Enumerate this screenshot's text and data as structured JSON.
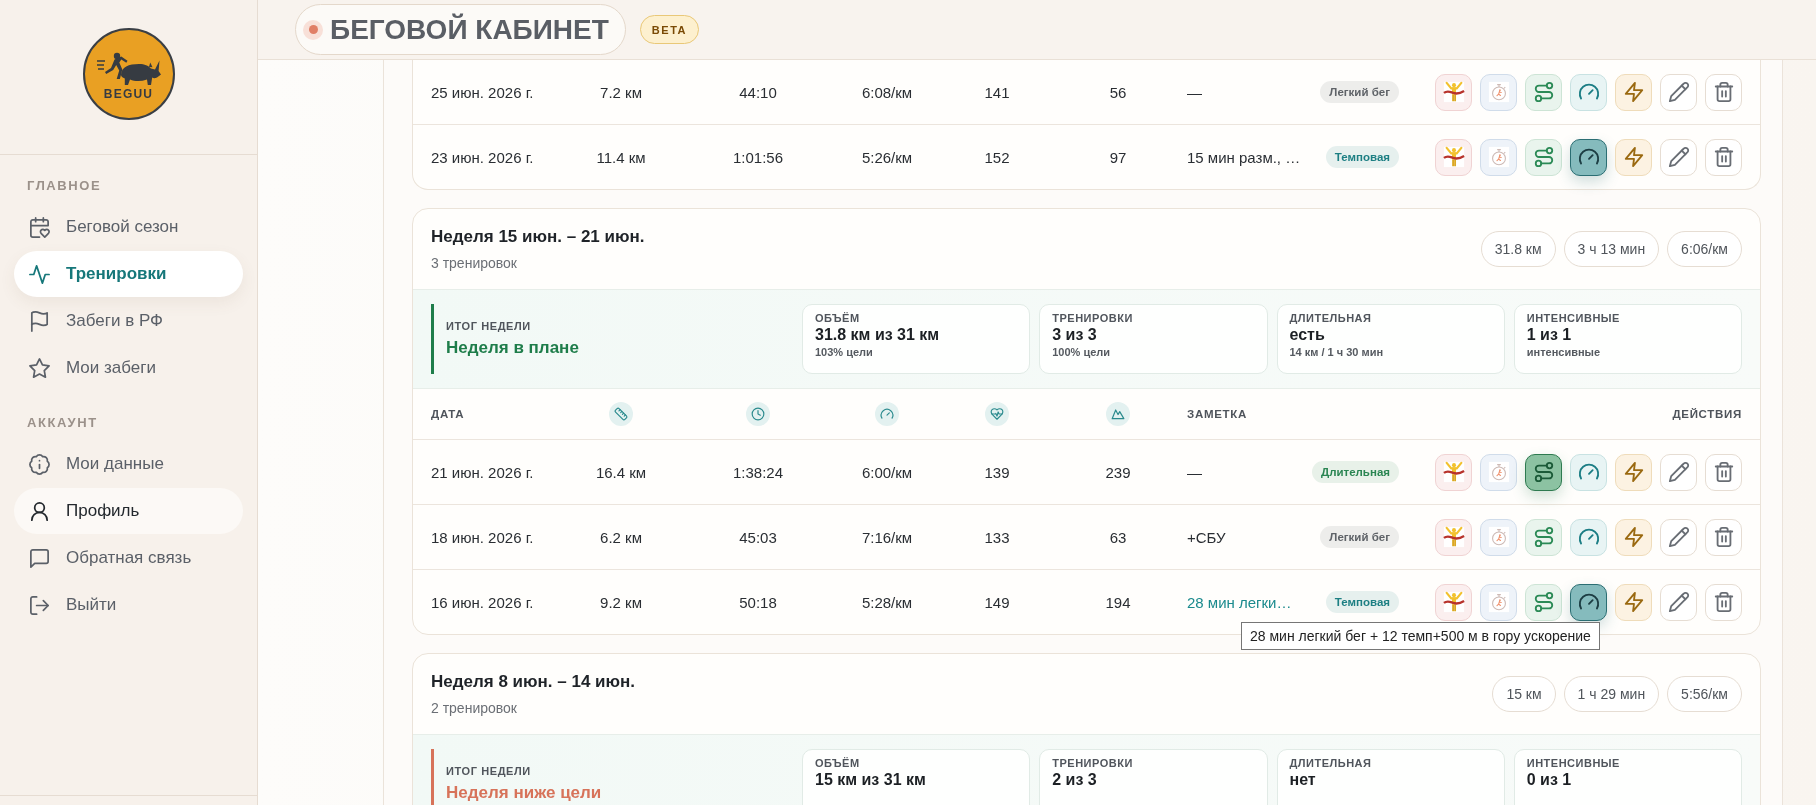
{
  "header": {
    "title": "БЕГОВОЙ КАБИНЕТ",
    "badge": "BETA"
  },
  "sidebar": {
    "logo_text": "BEGUU",
    "sections": [
      {
        "title": "ГЛАВНОЕ",
        "items": [
          {
            "label": "Беговой сезон",
            "selected": false,
            "hovered": false
          },
          {
            "label": "Тренировки",
            "selected": true,
            "hovered": false
          },
          {
            "label": "Забеги в РФ",
            "selected": false,
            "hovered": false
          },
          {
            "label": "Мои забеги",
            "selected": false,
            "hovered": false
          }
        ]
      },
      {
        "title": "АККАУНТ",
        "items": [
          {
            "label": "Мои данные",
            "selected": false,
            "hovered": false
          },
          {
            "label": "Профиль",
            "selected": false,
            "hovered": true
          },
          {
            "label": "Обратная связь",
            "selected": false,
            "hovered": false
          },
          {
            "label": "Выйти",
            "selected": false,
            "hovered": false
          }
        ]
      }
    ]
  },
  "weeks": [
    {
      "rows": [
        {
          "date": "25 июн. 2026 г.",
          "distance": "7.2 км",
          "duration": "44:10",
          "pace": "6:08/км",
          "heart_rate": "141",
          "elevation": "56",
          "note": "—",
          "note_hovered": false,
          "tag": {
            "text": "Легкий бег",
            "color": "#5f6368"
          },
          "markers": [
            {
              "kind": "race",
              "on": false
            },
            {
              "kind": "stopwatch",
              "on": false
            },
            {
              "kind": "route",
              "on": false
            },
            {
              "kind": "gauge",
              "on": false
            },
            {
              "kind": "bolt",
              "on": false
            }
          ]
        },
        {
          "date": "23 июн. 2026 г.",
          "distance": "11.4 км",
          "duration": "1:01:56",
          "pace": "5:26/км",
          "heart_rate": "152",
          "elevation": "97",
          "note": "15 мин разм., …",
          "note_hovered": false,
          "tag": {
            "text": "Темповая",
            "color": "#1d7f83"
          },
          "markers": [
            {
              "kind": "race",
              "on": false
            },
            {
              "kind": "stopwatch",
              "on": false
            },
            {
              "kind": "route",
              "on": false
            },
            {
              "kind": "gauge",
              "on": true
            },
            {
              "kind": "bolt",
              "on": false
            }
          ]
        }
      ]
    },
    {
      "title": "Неделя 15 июн. – 21 июн.",
      "count": "3 тренировок",
      "stats": [
        "31.8 км",
        "3 ч 13 мин",
        "6:06/км"
      ],
      "summary": {
        "label": "ИТОГ НЕДЕЛИ",
        "status": "Неделя в плане",
        "color": "#1e7d4a",
        "metrics": [
          {
            "label": "ОБЪЁМ",
            "value": "31.8 км из 31 км",
            "sub": "103% цели"
          },
          {
            "label": "ТРЕНИРОВКИ",
            "value": "3 из 3",
            "sub": "100% цели"
          },
          {
            "label": "ДЛИТЕЛЬНАЯ",
            "value": "есть",
            "sub": "14 км / 1 ч 30 мин"
          },
          {
            "label": "ИНТЕНСИВНЫЕ",
            "value": "1 из 1",
            "sub": "интенсивные"
          }
        ]
      },
      "columns": {
        "date": "ДАТА",
        "note": "ЗАМЕТКА",
        "actions": "ДЕЙСТВИЯ"
      },
      "rows": [
        {
          "date": "21 июн. 2026 г.",
          "distance": "16.4 км",
          "duration": "1:38:24",
          "pace": "6:00/км",
          "heart_rate": "139",
          "elevation": "239",
          "note": "—",
          "note_hovered": false,
          "tag": {
            "text": "Длительная",
            "color": "#2a8552"
          },
          "markers": [
            {
              "kind": "race",
              "on": false
            },
            {
              "kind": "stopwatch",
              "on": false
            },
            {
              "kind": "route",
              "on": true
            },
            {
              "kind": "gauge",
              "on": false
            },
            {
              "kind": "bolt",
              "on": false
            }
          ]
        },
        {
          "date": "18 июн. 2026 г.",
          "distance": "6.2 км",
          "duration": "45:03",
          "pace": "7:16/км",
          "heart_rate": "133",
          "elevation": "63",
          "note": "+СБУ",
          "note_hovered": false,
          "tag": {
            "text": "Легкий бег",
            "color": "#5f6368"
          },
          "markers": [
            {
              "kind": "race",
              "on": false
            },
            {
              "kind": "stopwatch",
              "on": false
            },
            {
              "kind": "route",
              "on": false
            },
            {
              "kind": "gauge",
              "on": false
            },
            {
              "kind": "bolt",
              "on": false
            }
          ]
        },
        {
          "date": "16 июн. 2026 г.",
          "distance": "9.2 км",
          "duration": "50:18",
          "pace": "5:28/км",
          "heart_rate": "149",
          "elevation": "194",
          "note": "28 мин легки…",
          "note_hovered": true,
          "note_tooltip": "28 мин легкий бег + 12 темп+500 м в гору ускорение",
          "tag": {
            "text": "Темповая",
            "color": "#1d7f83"
          },
          "markers": [
            {
              "kind": "race",
              "on": false
            },
            {
              "kind": "stopwatch",
              "on": false
            },
            {
              "kind": "route",
              "on": false
            },
            {
              "kind": "gauge",
              "on": true
            },
            {
              "kind": "bolt",
              "on": false
            }
          ]
        }
      ]
    },
    {
      "title": "Неделя 8 июн. – 14 июн.",
      "count": "2 тренировок",
      "stats": [
        "15 км",
        "1 ч 29 мин",
        "5:56/км"
      ],
      "summary": {
        "label": "ИТОГ НЕДЕЛИ",
        "status": "Неделя ниже цели",
        "color": "#d7735a",
        "metrics": [
          {
            "label": "ОБЪЁМ",
            "value": "15 км из 31 км"
          },
          {
            "label": "ТРЕНИРОВКИ",
            "value": "2 из 3"
          },
          {
            "label": "ДЛИТЕЛЬНАЯ",
            "value": "нет"
          },
          {
            "label": "ИНТЕНСИВНЫЕ",
            "value": "0 из 1"
          }
        ]
      }
    }
  ]
}
